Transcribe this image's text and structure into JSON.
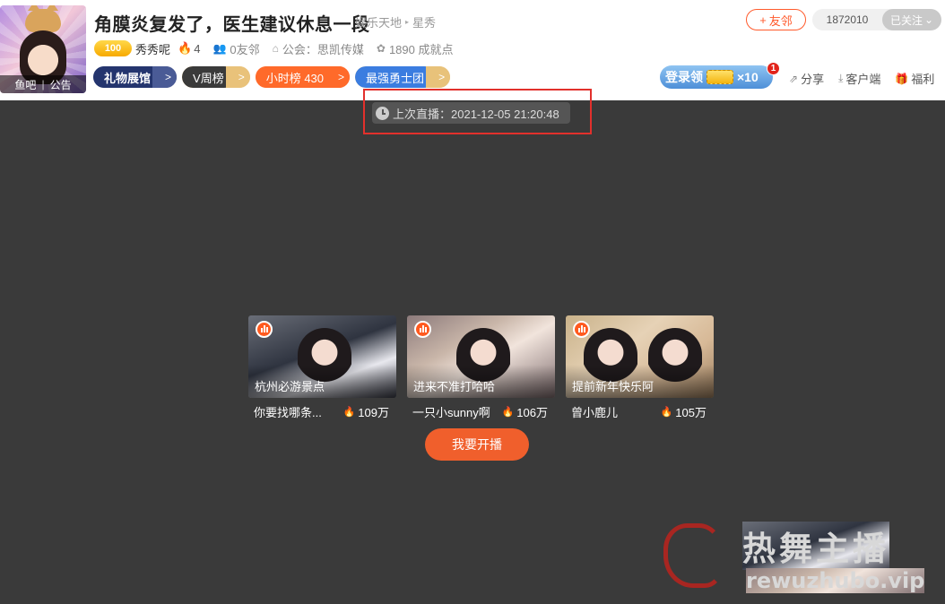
{
  "header": {
    "title": "角膜炎复发了，医生建议休息一段",
    "breadcrumb": [
      "娱乐天地",
      "星秀"
    ],
    "avatar_links": [
      "鱼吧",
      "公告"
    ],
    "level_badge": "100",
    "owner": "秀秀呢",
    "hot_count": "4",
    "friends": "0友邻",
    "guild": "公会：思凯传媒",
    "achievements": "1890 成就点",
    "pills": [
      {
        "label": "礼物展馆",
        "arrow": ">"
      },
      {
        "label": "V周榜",
        "arrow": ">"
      },
      {
        "label": "小时榜  430",
        "arrow": ">"
      },
      {
        "label": "最强勇士团",
        "arrow": ">"
      }
    ],
    "friend_button": "友邻",
    "follower_count": "1872010",
    "follow_state": "已关注",
    "login_reward": {
      "label": "登录领",
      "multiplier": "×10",
      "badge": "1"
    },
    "tools": [
      "分享",
      "客户端",
      "福利"
    ]
  },
  "main": {
    "last_live": "上次直播：2021-12-05 21:20:48",
    "recommendations": [
      {
        "caption": "杭州必游景点",
        "name": "你要找哪条...",
        "heat": "109万"
      },
      {
        "caption": "进来不准打哈哈",
        "name": "一只小sunny啊",
        "heat": "106万"
      },
      {
        "caption": "提前新年快乐阿",
        "name": "曾小鹿儿",
        "heat": "105万"
      }
    ],
    "start_button": "我要开播"
  },
  "watermark": {
    "title": "热舞主播",
    "url": "rewuzhubo.vip"
  },
  "colors": {
    "accent": "#f05f2c",
    "highlight": "#e2302c",
    "background": "#3a3a3a"
  }
}
